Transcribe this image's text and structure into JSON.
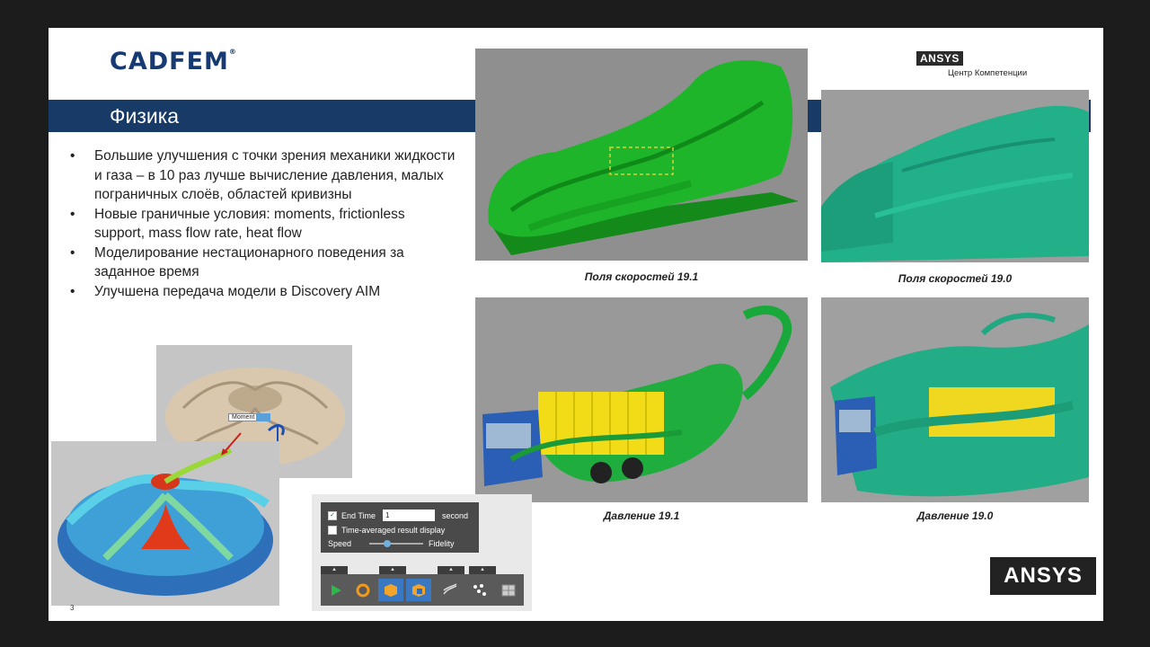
{
  "logo": {
    "text": "CADFEM",
    "reg": "®"
  },
  "title": "Физика",
  "ansys_small": {
    "box": "ANSYS",
    "sub": "Центр Компетенции"
  },
  "bullets": [
    "Большие улучшения с точки зрения механики жидкости и газа – в 10 раз лучше вычисление давления, малых пограничных слоёв, областей кривизны",
    "Новые граничные условия: moments, frictionless support, mass flow rate, heat flow",
    "Моделирование нестационарного поведения за заданное время",
    "Улучшена передача модели в Discovery AIM"
  ],
  "captions": {
    "vel_191": "Поля скоростей 19.1",
    "vel_190": "Поля скоростей 19.0",
    "press_191": "Давление 19.1",
    "press_190": "Давление 19.0"
  },
  "moment_label": "Moment",
  "panel": {
    "end_time_label": "End Time",
    "end_time_value": "1",
    "end_time_unit": "second",
    "time_avg_label": "Time-averaged result display",
    "speed_label": "Speed",
    "fidelity_label": "Fidelity"
  },
  "ansys_big": "ANSYS",
  "page_number": "3",
  "colors": {
    "title_bar": "#173a67",
    "green_flow": "#19b02a",
    "teal_flow": "#1fb58a",
    "truck_yellow": "#f2dc18"
  }
}
